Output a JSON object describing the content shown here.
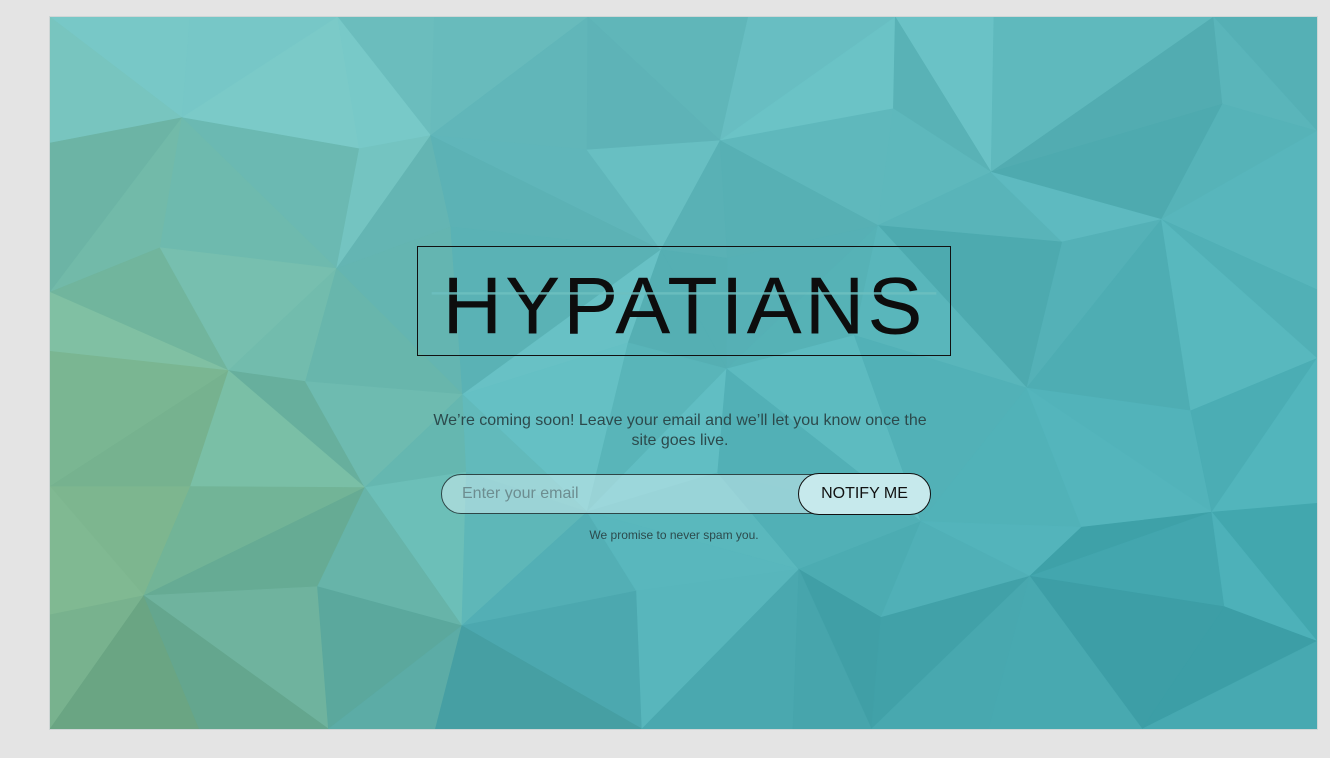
{
  "brand": {
    "logo_text": "HYPATIANS"
  },
  "hero": {
    "tagline": "We’re coming soon! Leave your email and we’ll let you know once the site goes live."
  },
  "signup": {
    "email_placeholder": "Enter your email",
    "notify_label": "NOTIFY ME",
    "promise": "We promise to never spam you."
  },
  "colors": {
    "bg_teal": "#6ec4c4",
    "bg_green": "#7fae80",
    "bg_deep_teal": "#2b9ea5",
    "text_dark": "#2c4a4c",
    "button_fill": "#c6e9ec"
  }
}
